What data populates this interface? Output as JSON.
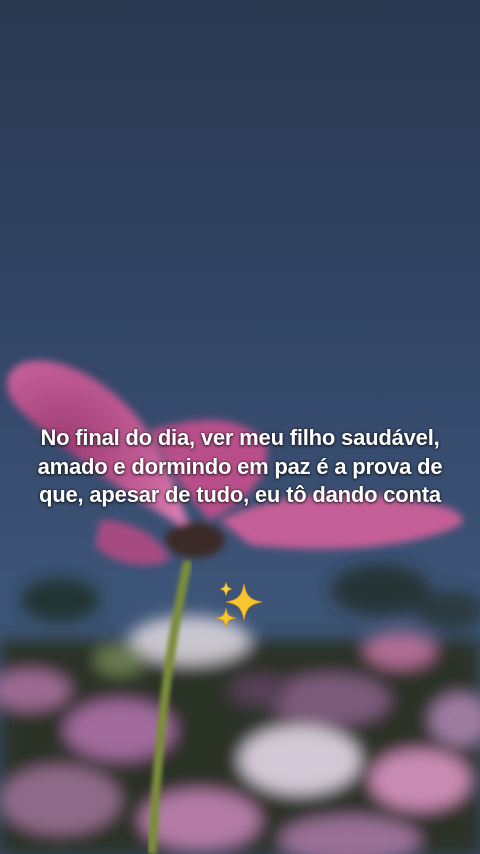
{
  "caption": {
    "text": "No final do dia, ver meu filho saudável, amado e dormindo em paz é a prova de que, apesar de tudo, eu tô dando conta"
  },
  "emoji": {
    "name": "sparkles-icon",
    "color": "#f6c531"
  },
  "colors": {
    "sky_top": "#2b3a50",
    "sky_bottom": "#3b5373",
    "petal": "#c25a92",
    "stem": "#7a8c3a"
  }
}
